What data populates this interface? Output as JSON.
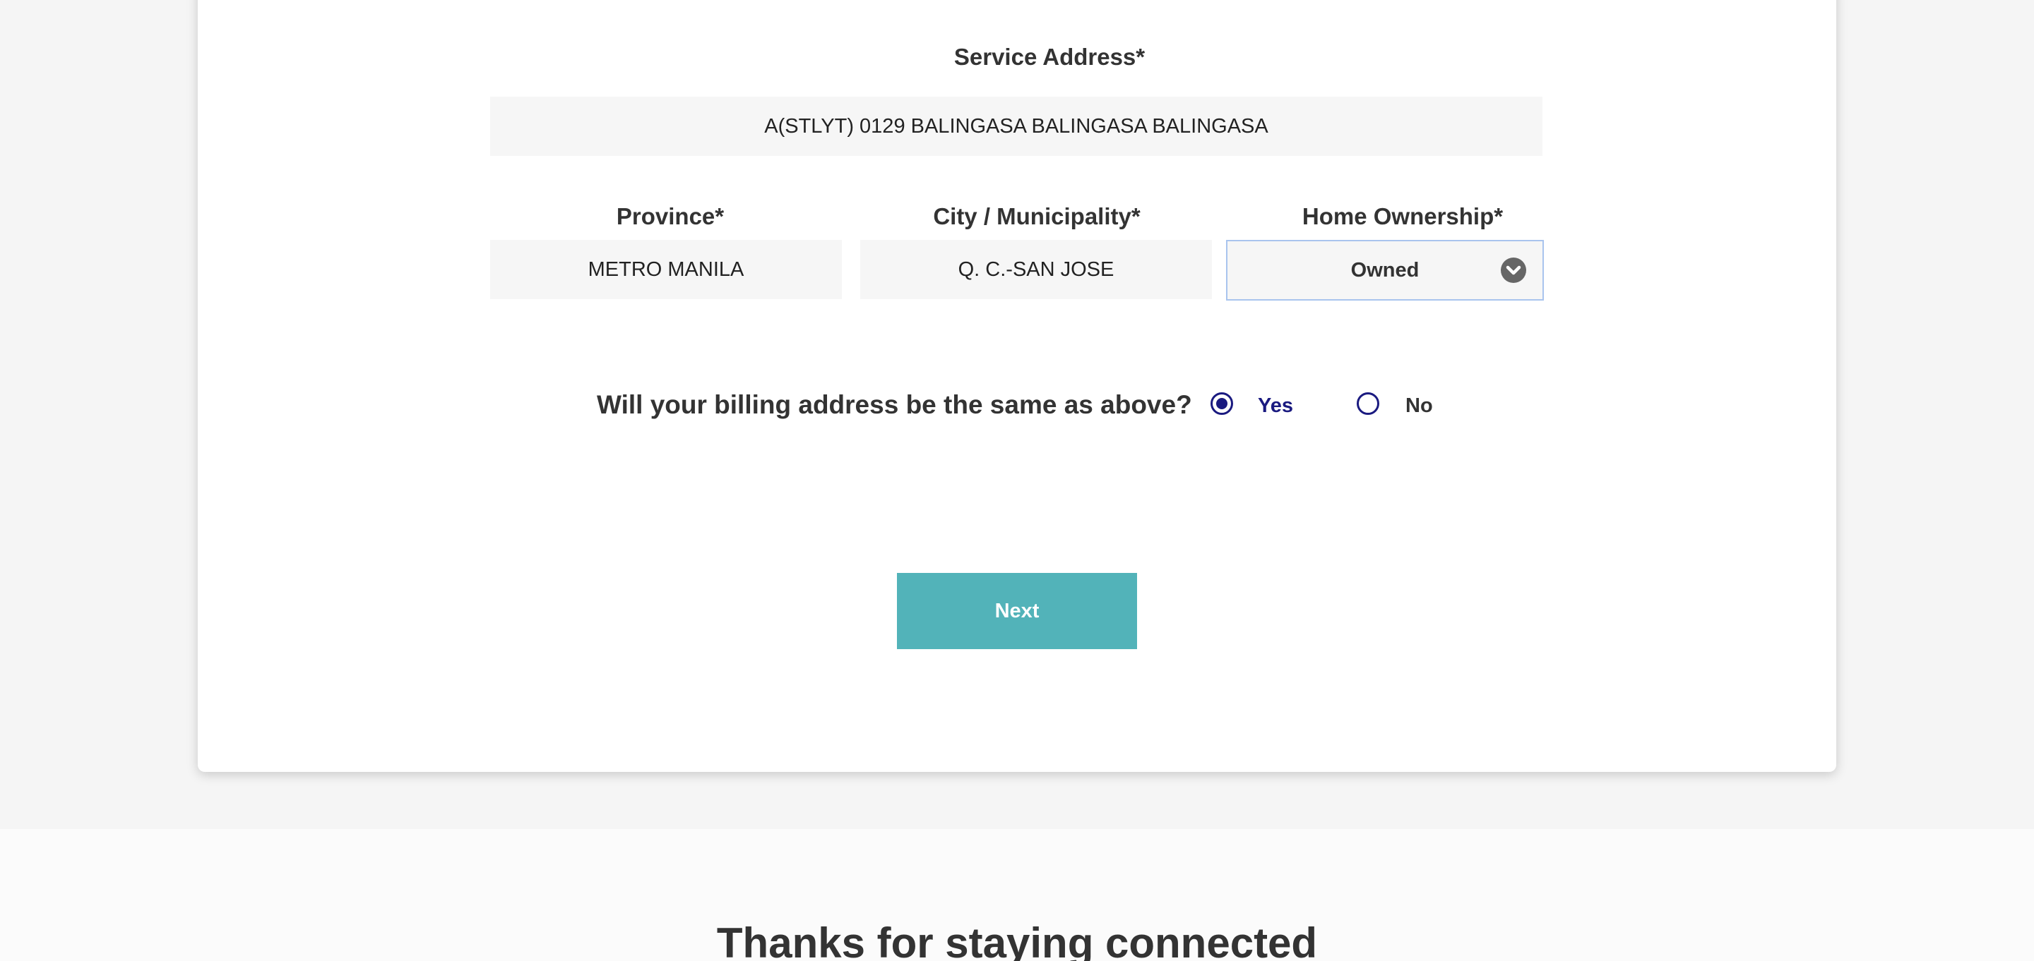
{
  "form": {
    "service_address_label": "Service Address*",
    "service_address_value": "A(STLYT) 0129 BALINGASA BALINGASA BALINGASA",
    "province_label": "Province*",
    "province_value": "METRO MANILA",
    "city_label": "City / Municipality*",
    "city_value": "Q. C.-SAN JOSE",
    "home_ownership_label": "Home Ownership*",
    "home_ownership_value": "Owned",
    "billing_question": "Will your billing address be the same as above?",
    "billing_options": [
      {
        "label": "Yes",
        "selected": true
      },
      {
        "label": "No",
        "selected": false
      }
    ],
    "next_label": "Next"
  },
  "footer": {
    "title": "Thanks for staying connected"
  },
  "colors": {
    "accent": "#52b3b9",
    "radio": "#1a1a80",
    "text": "#333333"
  },
  "icons": {
    "select": "chevron-down-icon"
  }
}
